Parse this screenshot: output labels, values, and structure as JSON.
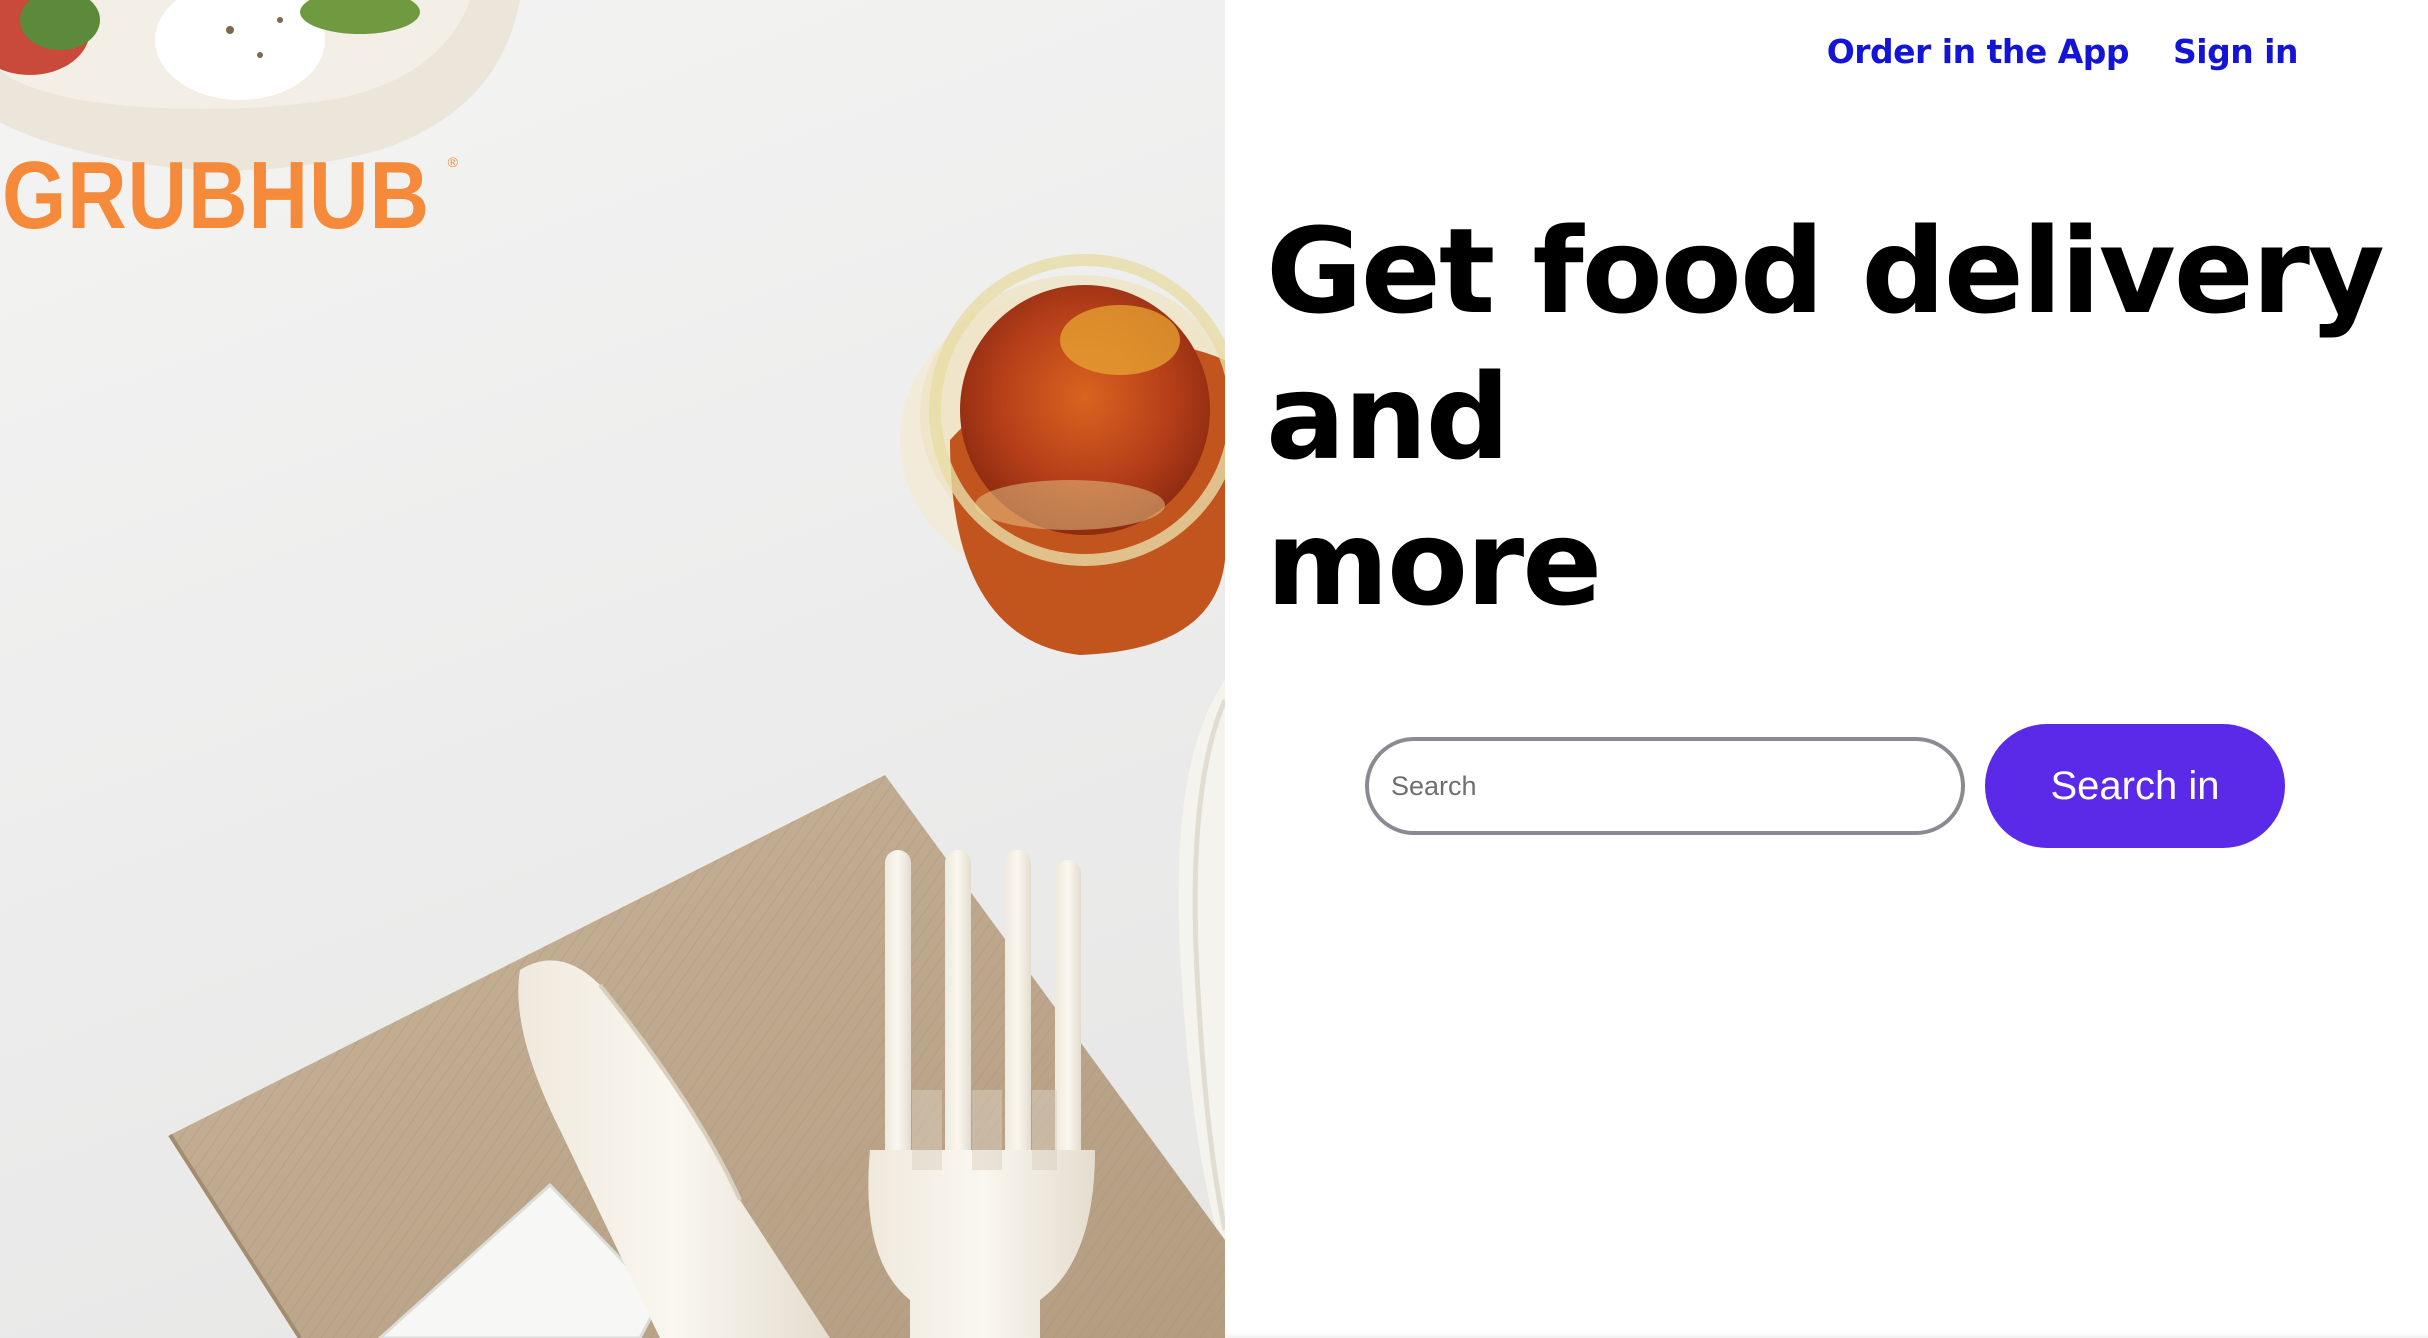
{
  "brand": {
    "logo_text": "GRUBHUB",
    "logo_mark": "®",
    "logo_color": "#f58a3a"
  },
  "nav": {
    "order_in_app": "Order in the App",
    "sign_in": "Sign in",
    "link_color": "#1414d6"
  },
  "hero": {
    "headline_line1": "Get food delivery",
    "headline_line2": "and",
    "headline_line3": "more",
    "image_icon": "food-delivery-photo"
  },
  "search": {
    "placeholder": "Search",
    "value": "",
    "button_label": "Search in",
    "button_color": "#5b2ae8"
  }
}
